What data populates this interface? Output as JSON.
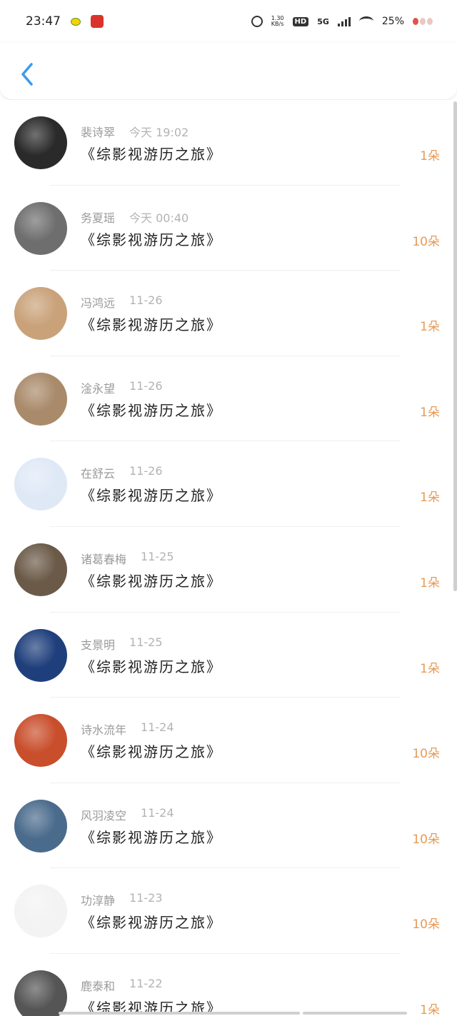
{
  "status_bar": {
    "time": "23:47",
    "net_speed": "1.30\nKB/s",
    "hd": "HD",
    "network": "5G",
    "battery": "25%"
  },
  "header": {
    "back_icon": "chevron-left-icon",
    "accent": "#3a9be9"
  },
  "items": [
    {
      "name": "裴诗翠",
      "time": "今天 19:02",
      "book": "《综影视游历之旅》",
      "count": "1朵",
      "avatar_color": "#2a2a2a"
    },
    {
      "name": "务夏瑶",
      "time": "今天 00:40",
      "book": "《综影视游历之旅》",
      "count": "10朵",
      "avatar_color": "#6e6e6e"
    },
    {
      "name": "冯鸿远",
      "time": "11-26",
      "book": "《综影视游历之旅》",
      "count": "1朵",
      "avatar_color": "#c9a27a"
    },
    {
      "name": "淦永望",
      "time": "11-26",
      "book": "《综影视游历之旅》",
      "count": "1朵",
      "avatar_color": "#a98a6a"
    },
    {
      "name": "在舒云",
      "time": "11-26",
      "book": "《综影视游历之旅》",
      "count": "1朵",
      "avatar_color": "#dfe9f6"
    },
    {
      "name": "诸葛春梅",
      "time": "11-25",
      "book": "《综影视游历之旅》",
      "count": "1朵",
      "avatar_color": "#6b5a48"
    },
    {
      "name": "支景明",
      "time": "11-25",
      "book": "《综影视游历之旅》",
      "count": "1朵",
      "avatar_color": "#1f3f7c"
    },
    {
      "name": "诗水流年",
      "time": "11-24",
      "book": "《综影视游历之旅》",
      "count": "10朵",
      "avatar_color": "#c94e2c"
    },
    {
      "name": "风羽凌空",
      "time": "11-24",
      "book": "《综影视游历之旅》",
      "count": "10朵",
      "avatar_color": "#4a6b8c"
    },
    {
      "name": "功淳静",
      "time": "11-23",
      "book": "《综影视游历之旅》",
      "count": "10朵",
      "avatar_color": "#f3f3f3"
    },
    {
      "name": "鹿泰和",
      "time": "11-22",
      "book": "《综影视游历之旅》",
      "count": "1朵",
      "avatar_color": "#555555"
    }
  ]
}
